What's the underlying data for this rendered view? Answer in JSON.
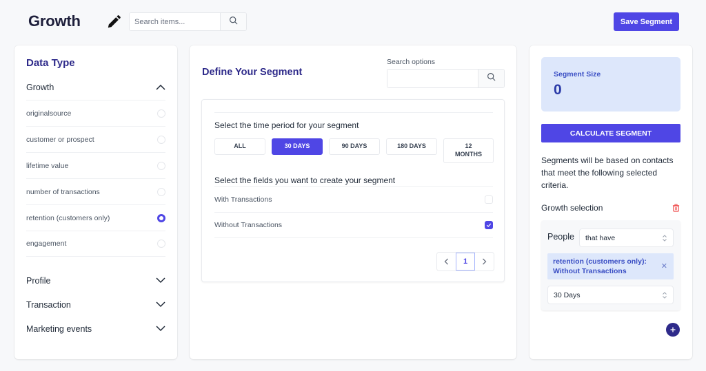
{
  "header": {
    "title": "Growth",
    "edit_icon": "pencil-icon",
    "search_placeholder": "Search items...",
    "search_value": "",
    "search_icon": "search-icon",
    "save_label": "Save Segment"
  },
  "data_type_panel": {
    "title": "Data Type",
    "groups": [
      {
        "label": "Growth",
        "expanded": true,
        "icon": "chevron-up-icon"
      },
      {
        "label": "Profile",
        "expanded": false,
        "icon": "chevron-down-icon"
      },
      {
        "label": "Transaction",
        "expanded": false,
        "icon": "chevron-down-icon"
      },
      {
        "label": "Marketing events",
        "expanded": false,
        "icon": "chevron-down-icon"
      }
    ],
    "items": [
      {
        "label": "originalsource",
        "selected": false
      },
      {
        "label": "customer or prospect",
        "selected": false
      },
      {
        "label": "lifetime value",
        "selected": false
      },
      {
        "label": "number of transactions",
        "selected": false
      },
      {
        "label": "retention (customers only)",
        "selected": true
      },
      {
        "label": "engagement",
        "selected": false
      }
    ]
  },
  "define_panel": {
    "title": "Define Your Segment",
    "search_label": "Search options",
    "search_value": "",
    "time_period_label": "Select the time period for your segment",
    "periods": [
      {
        "label": "ALL",
        "active": false
      },
      {
        "label": "30 DAYS",
        "active": true
      },
      {
        "label": "90 DAYS",
        "active": false
      },
      {
        "label": "180 DAYS",
        "active": false
      },
      {
        "label": "12 MONTHS",
        "active": false
      }
    ],
    "fields_label": "Select the fields you want to create your segment",
    "fields": [
      {
        "label": "With Transactions",
        "checked": false
      },
      {
        "label": "Without Transactions",
        "checked": true
      }
    ],
    "pagination": {
      "current_page": "1"
    }
  },
  "summary_panel": {
    "size_label": "Segment Size",
    "size_value": "0",
    "calculate_label": "CALCULATE SEGMENT",
    "description": "Segments will be based on contacts that meet the following selected criteria.",
    "selection_label": "Growth selection",
    "criteria": {
      "subject": "People",
      "condition": "that have",
      "chip": "retention (customers only): Without Transactions",
      "period": "30 Days"
    }
  },
  "colors": {
    "accent": "#4f46e5",
    "heading": "#2e2a8a",
    "chip_bg": "#dde7fb",
    "danger": "#ef4444",
    "page_bg": "#f7f8fa"
  }
}
